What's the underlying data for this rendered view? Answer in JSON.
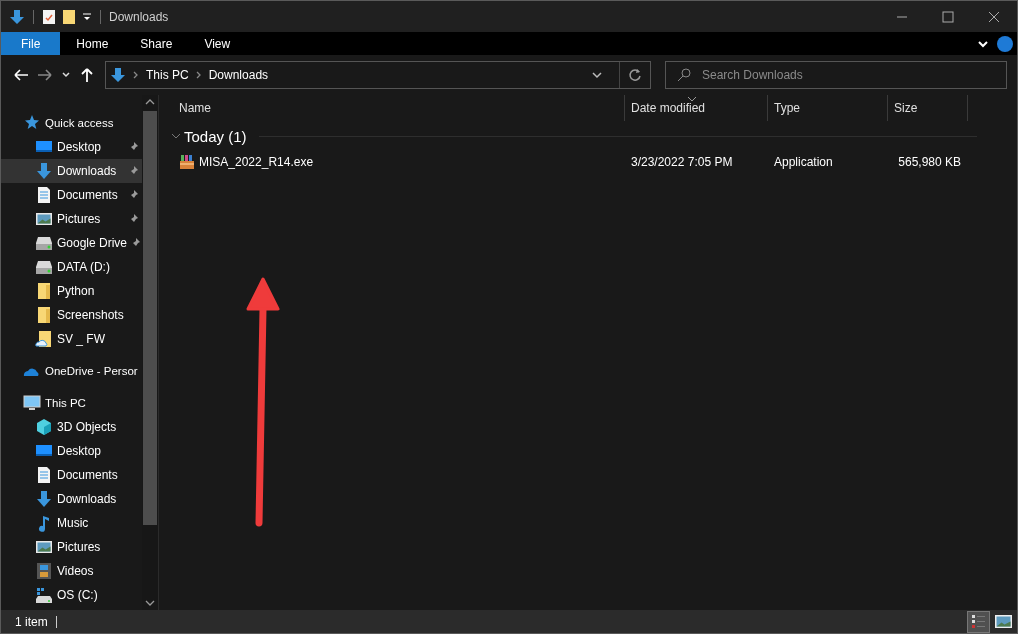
{
  "window": {
    "title": "Downloads"
  },
  "ribbon": {
    "tabs": [
      {
        "label": "File",
        "selected": true
      },
      {
        "label": "Home",
        "selected": false
      },
      {
        "label": "Share",
        "selected": false
      },
      {
        "label": "View",
        "selected": false
      }
    ]
  },
  "address_bar": {
    "path": [
      "This PC",
      "Downloads"
    ]
  },
  "search": {
    "placeholder": "Search Downloads"
  },
  "navigation": {
    "sections": [
      {
        "label": "Quick access",
        "kind": "star",
        "selected": false,
        "children": [
          {
            "label": "Desktop",
            "kind": "desktop",
            "pinned": true,
            "selected": false
          },
          {
            "label": "Downloads",
            "kind": "download",
            "pinned": true,
            "selected": true
          },
          {
            "label": "Documents",
            "kind": "document",
            "pinned": true,
            "selected": false
          },
          {
            "label": "Pictures",
            "kind": "picture",
            "pinned": true,
            "selected": false
          },
          {
            "label": "Google Drive",
            "kind": "drive",
            "pinned": true,
            "selected": false
          },
          {
            "label": "DATA (D:)",
            "kind": "drive",
            "pinned": false,
            "selected": false
          },
          {
            "label": "Python",
            "kind": "folder",
            "pinned": false,
            "selected": false
          },
          {
            "label": "Screenshots",
            "kind": "folder",
            "pinned": false,
            "selected": false
          },
          {
            "label": "SV _ FW",
            "kind": "cloud-folder",
            "pinned": false,
            "selected": false
          }
        ]
      },
      {
        "label": "OneDrive - Persor",
        "kind": "cloud",
        "selected": false
      },
      {
        "label": "This PC",
        "kind": "computer",
        "selected": false,
        "children": [
          {
            "label": "3D Objects",
            "kind": "cube",
            "pinned": false,
            "selected": false
          },
          {
            "label": "Desktop",
            "kind": "desktop",
            "pinned": false,
            "selected": false
          },
          {
            "label": "Documents",
            "kind": "document",
            "pinned": false,
            "selected": false
          },
          {
            "label": "Downloads",
            "kind": "download",
            "pinned": false,
            "selected": false
          },
          {
            "label": "Music",
            "kind": "music",
            "pinned": false,
            "selected": false
          },
          {
            "label": "Pictures",
            "kind": "picture",
            "pinned": false,
            "selected": false
          },
          {
            "label": "Videos",
            "kind": "video",
            "pinned": false,
            "selected": false
          },
          {
            "label": "OS (C:)",
            "kind": "os-drive",
            "pinned": false,
            "selected": false
          }
        ]
      }
    ]
  },
  "file_list": {
    "columns": [
      {
        "label": "Name",
        "sorted": false
      },
      {
        "label": "Date modified",
        "sorted": true
      },
      {
        "label": "Type",
        "sorted": false
      },
      {
        "label": "Size",
        "sorted": false
      }
    ],
    "groups": [
      {
        "label": "Today (1)",
        "expanded": true,
        "files": [
          {
            "name": "MISA_2022_R14.exe",
            "date_modified": "3/23/2022 7:05 PM",
            "type": "Application",
            "size": "565,980 KB",
            "selected": false
          }
        ]
      }
    ]
  },
  "status_bar": {
    "item_count": "1 item",
    "views": [
      {
        "kind": "details",
        "selected": true
      },
      {
        "kind": "large-icons",
        "selected": false
      }
    ]
  }
}
